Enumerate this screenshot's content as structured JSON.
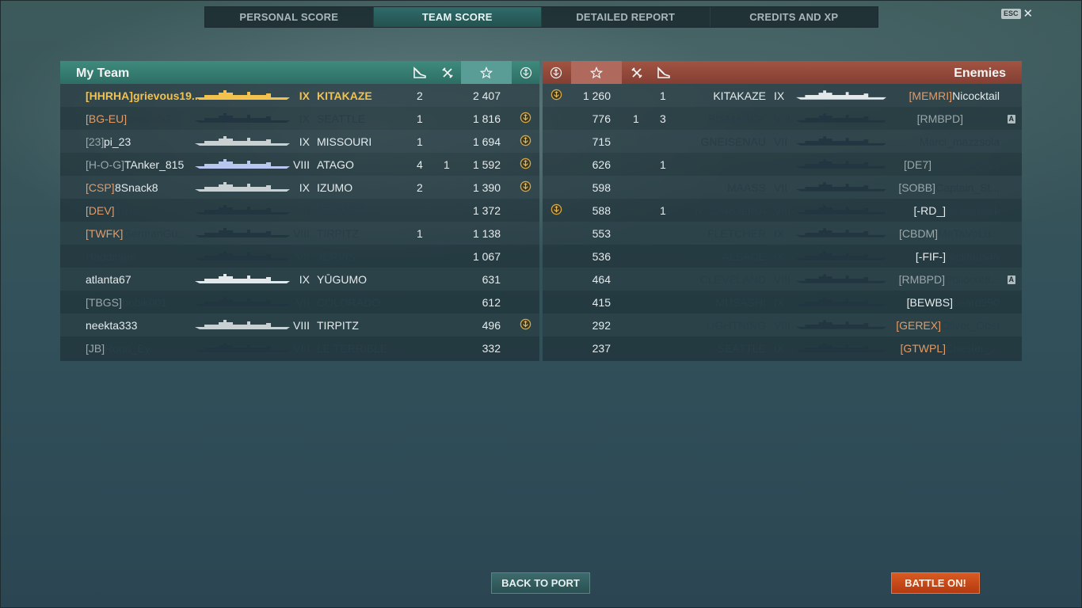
{
  "tabs": [
    {
      "label": "PERSONAL SCORE",
      "active": false
    },
    {
      "label": "TEAM SCORE",
      "active": true
    },
    {
      "label": "DETAILED REPORT",
      "active": false
    },
    {
      "label": "CREDITS AND XP",
      "active": false
    }
  ],
  "esc_label": "ESC",
  "close_glyph": "✕",
  "my_team": {
    "title": "My Team",
    "columns": [
      "planes-destroyed-icon",
      "ships-destroyed-icon",
      "star-score-icon",
      "base-capture-icon"
    ],
    "rows": [
      {
        "clan": "[HHRHA]",
        "name": "grievous19...",
        "tier": "IX",
        "ship": "KITAKAZE",
        "c1": "2",
        "c2": "",
        "score": "2 407",
        "badge": false,
        "state": "me",
        "clan_color": "gold",
        "silhouette_color": "#f2c14e"
      },
      {
        "clan": "[BG-EU]",
        "name": "proper92",
        "tier": "IX",
        "ship": "SEATTLE",
        "c1": "1",
        "c2": "",
        "score": "1 816",
        "badge": true,
        "state": "dead",
        "clan_color": "orange",
        "silhouette_color": "#223641"
      },
      {
        "clan": "[23]",
        "name": "pi_23",
        "tier": "IX",
        "ship": "MISSOURI",
        "c1": "1",
        "c2": "",
        "score": "1 694",
        "badge": true,
        "state": "alive",
        "clan_color": "gray",
        "silhouette_color": "#c8d0d2"
      },
      {
        "clan": "[H-O-G]",
        "name": "TAnker_815",
        "tier": "VIII",
        "ship": "ATAGO",
        "c1": "4",
        "c2": "1",
        "score": "1 592",
        "badge": true,
        "state": "alive",
        "clan_color": "gray",
        "silhouette_color": "#b9c6f0"
      },
      {
        "clan": "[CSP]",
        "name": "8Snack8",
        "tier": "IX",
        "ship": "IZUMO",
        "c1": "2",
        "c2": "",
        "score": "1 390",
        "badge": true,
        "state": "alive",
        "clan_color": "orange",
        "silhouette_color": "#c8d0d2"
      },
      {
        "clan": "[DEV]",
        "name": "T67",
        "tier": "VII",
        "ship": "ATLANTA",
        "c1": "",
        "c2": "",
        "score": "1 372",
        "badge": false,
        "state": "dead",
        "clan_color": "orange",
        "silhouette_color": "#223641"
      },
      {
        "clan": "[TWFK]",
        "name": "GermanGu...",
        "tier": "VIII",
        "ship": "TIRPITZ",
        "c1": "1",
        "c2": "",
        "score": "1 138",
        "badge": false,
        "state": "dead",
        "clan_color": "orange",
        "silhouette_color": "#223641"
      },
      {
        "clan": "",
        "name": "Haddinger",
        "tier": "VII",
        "ship": "JERVIS",
        "c1": "",
        "c2": "",
        "score": "1 067",
        "badge": false,
        "state": "dead",
        "clan_color": "gray",
        "silhouette_color": "#223641"
      },
      {
        "clan": "",
        "name": "atlanta67",
        "tier": "IX",
        "ship": "YŪGUMO",
        "c1": "",
        "c2": "",
        "score": "631",
        "badge": false,
        "state": "alive",
        "clan_color": "gray",
        "silhouette_color": "#e3e8ea"
      },
      {
        "clan": "[TBGS]",
        "name": "bobik001",
        "tier": "VII",
        "ship": "COLORADO",
        "c1": "",
        "c2": "",
        "score": "612",
        "badge": false,
        "state": "dead",
        "clan_color": "gray",
        "silhouette_color": "#223641"
      },
      {
        "clan": "",
        "name": "neekta333",
        "tier": "VIII",
        "ship": "TIRPITZ",
        "c1": "",
        "c2": "",
        "score": "496",
        "badge": true,
        "state": "alive",
        "clan_color": "gray",
        "silhouette_color": "#c8d0d2"
      },
      {
        "clan": "[JB]",
        "name": "Roon_Ey",
        "tier": "VIII",
        "ship": "LE TERRIBLE",
        "c1": "",
        "c2": "",
        "score": "332",
        "badge": false,
        "state": "dead",
        "clan_color": "gray",
        "silhouette_color": "#223641"
      }
    ]
  },
  "enemies": {
    "title": "Enemies",
    "columns": [
      "base-capture-icon",
      "star-score-icon",
      "ships-destroyed-icon",
      "planes-destroyed-icon"
    ],
    "rows": [
      {
        "badge": true,
        "score": "1 260",
        "c2": "",
        "c1": "1",
        "ship": "KITAKAZE",
        "tier": "IX",
        "clan": "[MEMRI]",
        "name": "Nicocktail",
        "state": "alive",
        "clan_color": "orange",
        "lb": false,
        "silhouette_color": "#e3e8ea"
      },
      {
        "badge": false,
        "score": "776",
        "c2": "1",
        "c1": "3",
        "ship": "BISMARCK",
        "tier": "VIII",
        "clan": "[RMBPD]",
        "name": "Silvano",
        "state": "dead",
        "clan_color": "gray",
        "lb": true,
        "silhouette_color": "#223641"
      },
      {
        "badge": false,
        "score": "715",
        "c2": "",
        "c1": "",
        "ship": "GNEISENAU",
        "tier": "VII",
        "clan": "",
        "name": "Marci_mazzsola",
        "state": "dead",
        "clan_color": "gray",
        "lb": false,
        "silhouette_color": "#223641"
      },
      {
        "badge": false,
        "score": "626",
        "c2": "",
        "c1": "1",
        "ship": "FIJI",
        "tier": "VII",
        "clan": "[DE7]",
        "name": "Scouse_2014",
        "state": "dead",
        "clan_color": "gray",
        "lb": false,
        "silhouette_color": "#223641"
      },
      {
        "badge": false,
        "score": "598",
        "c2": "",
        "c1": "",
        "ship": "MAASS",
        "tier": "VII",
        "clan": "[SOBB]",
        "name": "Captain_St...",
        "state": "dead",
        "clan_color": "gray",
        "lb": false,
        "silhouette_color": "#223641"
      },
      {
        "badge": true,
        "score": "588",
        "c2": "",
        "c1": "1",
        "ship": "N. CAROLINA",
        "tier": "VIII",
        "clan": "[-RD_]",
        "name": "streethawk",
        "state": "dead",
        "clan_color": "lightgray",
        "lb": false,
        "silhouette_color": "#223641"
      },
      {
        "badge": false,
        "score": "553",
        "c2": "",
        "c1": "",
        "ship": "FLETCHER",
        "tier": "IX",
        "clan": "[CBDM]",
        "name": "MeTaVoLu...",
        "state": "dead",
        "clan_color": "gray",
        "lb": false,
        "silhouette_color": "#223641"
      },
      {
        "badge": false,
        "score": "536",
        "c2": "",
        "c1": "",
        "ship": "ALSACE",
        "tier": "IX",
        "clan": "[-FIF-]",
        "name": "Nicklaus45",
        "state": "dead",
        "clan_color": "lightgray",
        "lb": false,
        "silhouette_color": "#223641"
      },
      {
        "badge": false,
        "score": "464",
        "c2": "",
        "c1": "",
        "ship": "CLEVELAND",
        "tier": "VIII",
        "clan": "[RMBPD]",
        "name": "Poliorxeti...",
        "state": "dead",
        "clan_color": "gray",
        "lb": true,
        "silhouette_color": "#223641"
      },
      {
        "badge": false,
        "score": "415",
        "c2": "",
        "c1": "",
        "ship": "MUSASHI",
        "tier": "IX",
        "clan": "[BEWBS]",
        "name": "beard990",
        "state": "dead",
        "clan_color": "lightgray",
        "lb": false,
        "silhouette_color": "#223641"
      },
      {
        "badge": false,
        "score": "292",
        "c2": "",
        "c1": "",
        "ship": "LIGHTNING",
        "tier": "VIII",
        "clan": "[GEREX]",
        "name": "Oliver_Obst",
        "state": "dead",
        "clan_color": "orange",
        "lb": false,
        "silhouette_color": "#223641"
      },
      {
        "badge": false,
        "score": "237",
        "c2": "",
        "c1": "",
        "ship": "SEATTLE",
        "tier": "IX",
        "clan": "[GTWPL]",
        "name": "Chester_...",
        "state": "dead",
        "clan_color": "orange",
        "lb": false,
        "silhouette_color": "#223641"
      }
    ],
    "lb_label": "A"
  },
  "buttons": {
    "back_to_port": "BACK TO PORT",
    "battle_on": "BATTLE ON!"
  },
  "colors": {
    "my_team_header": "#3f8a7d",
    "enemy_header": "#a25442",
    "player_highlight": "#f2c14e",
    "clan_orange": "#e29b69",
    "battle_button": "#d95a22"
  }
}
